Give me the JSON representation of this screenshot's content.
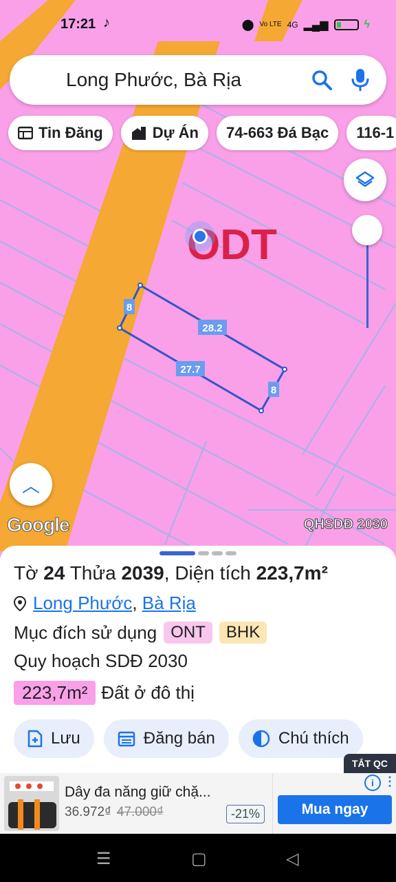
{
  "status": {
    "time": "17:21",
    "network": "4G",
    "volte": "Vo LTE"
  },
  "search": {
    "query": "Long Phước, Bà Rịa"
  },
  "chips": [
    {
      "icon": "listing-icon",
      "label": "Tin Đăng"
    },
    {
      "icon": "project-icon",
      "label": "Dự Án"
    },
    {
      "icon": "",
      "label": "74-663 Đá Bạc"
    },
    {
      "icon": "",
      "label": "116-1"
    }
  ],
  "map": {
    "zone_label": "ODT",
    "edges": [
      "8",
      "28.2",
      "27.7",
      "8"
    ],
    "logo": "Google",
    "plan_label": "QHSDĐ 2030",
    "colors": {
      "land": "#f9a0e8",
      "road": "#f5a833",
      "parcel": "#3a63d6",
      "zone_text": "#d8143a"
    }
  },
  "parcel": {
    "to_prefix": "Tờ",
    "to_number": "24",
    "thua_prefix": "Thửa",
    "thua_number": "2039",
    "area_prefix": ", Diện tích",
    "area": "223,7m²",
    "location": {
      "ward": "Long Phước",
      "city": "Bà Rịa",
      "separator": ","
    },
    "purpose_label": "Mục đích sử dụng",
    "purpose_tags": [
      "ONT",
      "BHK"
    ],
    "plan_title": "Quy hoạch SDĐ 2030",
    "plan_area": "223,7m²",
    "plan_type": "Đất ở đô thị"
  },
  "actions": [
    {
      "icon": "add-file-icon",
      "label": "Lưu"
    },
    {
      "icon": "calendar-icon",
      "label": "Đăng bán"
    },
    {
      "icon": "contrast-icon",
      "label": "Chú thích"
    }
  ],
  "ad": {
    "close_label": "TẮT QC",
    "title": "Dây đa năng giữ chặ...",
    "price": "36.972₫",
    "old_price": "47.000₫",
    "discount": "-21%",
    "cta": "Mua ngay"
  }
}
